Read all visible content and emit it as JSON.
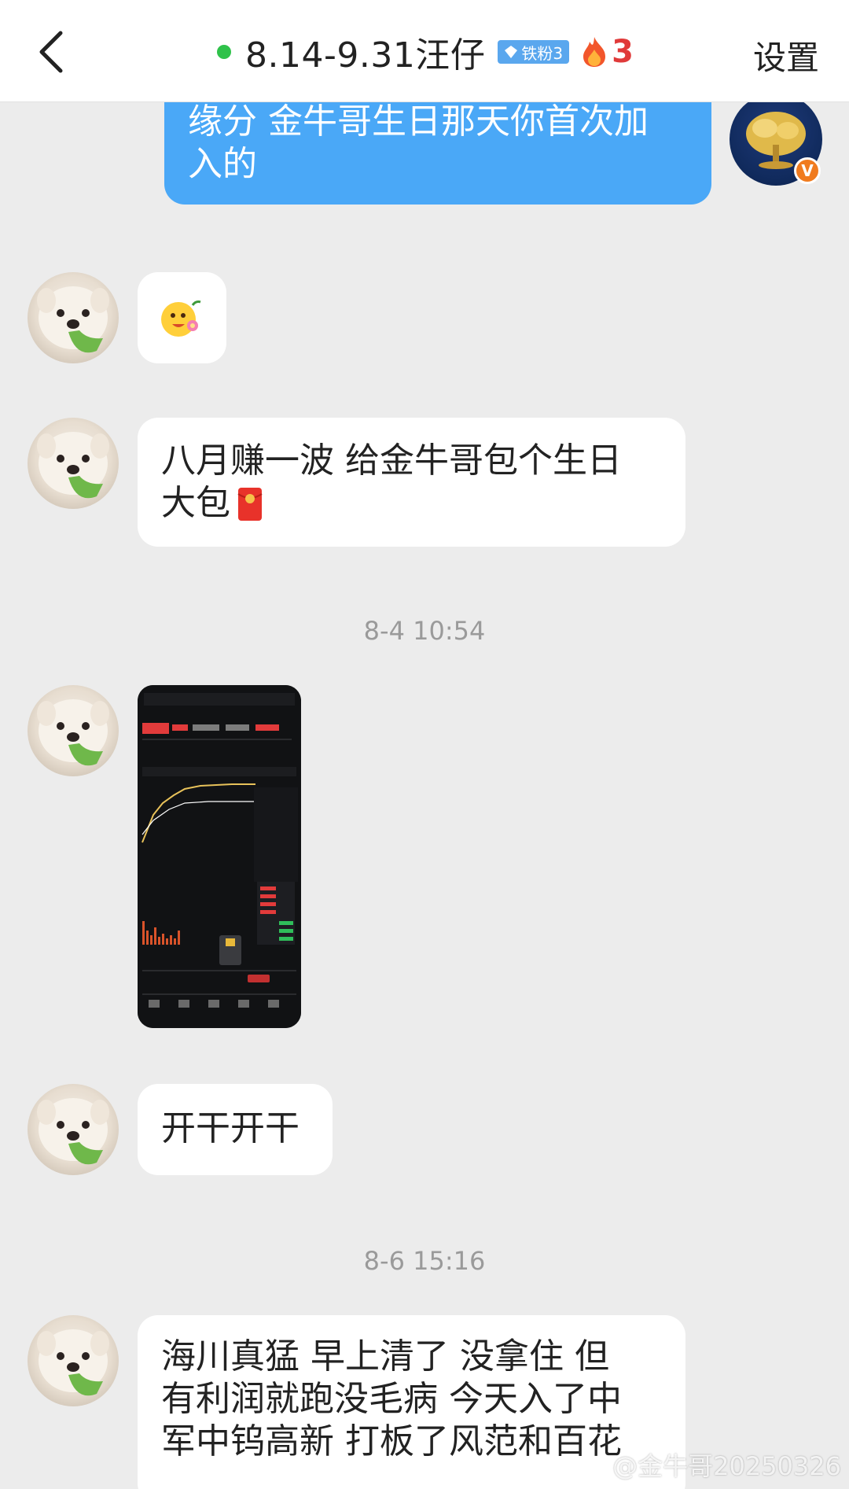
{
  "header": {
    "title": "8.14-9.31汪仔",
    "fan_badge": "铁粉3",
    "flame_count": "3",
    "settings_label": "设置"
  },
  "messages": {
    "m1_line1": "缘分 金牛哥生日那天你首次加",
    "m1_line2": "入的",
    "m3_line1": "八月赚一波 给金牛哥包个生日",
    "m3_line2": "大包",
    "time1": "8-4 10:54",
    "m5": "开干开干",
    "time2": "8-6 15:16",
    "m6_line1": "海川真猛 早上清了 没拿住 但",
    "m6_line2": "有利润就跑没毛病 今天入了中",
    "m6_line3": "军中钨高新 打板了风范和百花"
  },
  "watermark": "@金牛哥20250326",
  "colors": {
    "my_bubble": "#4aa8f7",
    "online": "#2fc24a",
    "flame": "#e03a3a"
  }
}
